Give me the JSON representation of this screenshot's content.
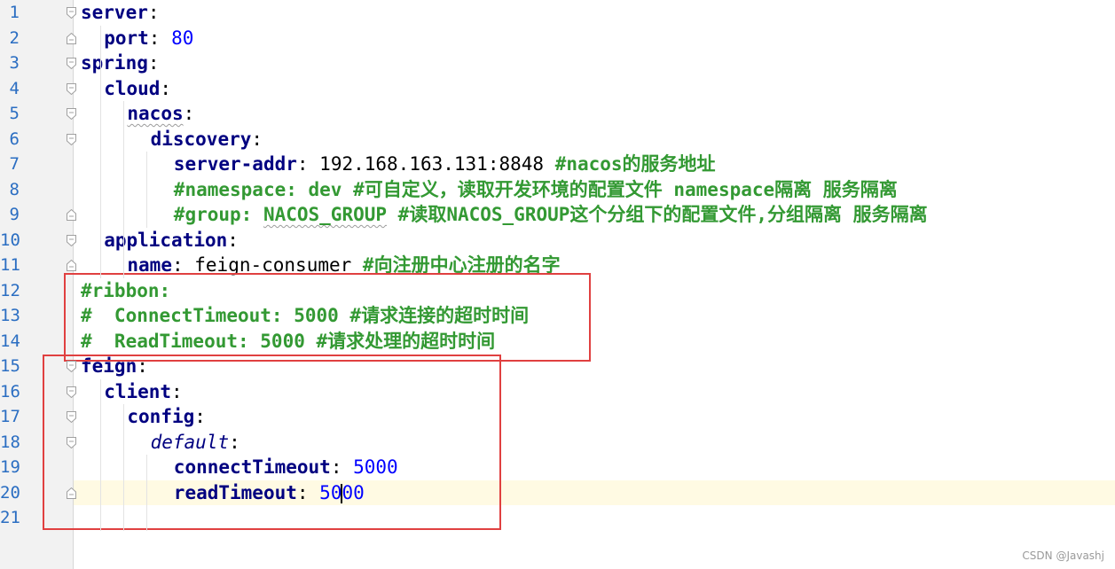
{
  "editor": {
    "language": "yaml",
    "lines": [
      {
        "n": "1",
        "indent": 0,
        "tokens": [
          {
            "t": "server",
            "c": "key"
          },
          {
            "t": ":",
            "c": "punct"
          }
        ]
      },
      {
        "n": "2",
        "indent": 1,
        "tokens": [
          {
            "t": "port",
            "c": "key"
          },
          {
            "t": ": ",
            "c": "punct"
          },
          {
            "t": "80",
            "c": "num"
          }
        ]
      },
      {
        "n": "3",
        "indent": 0,
        "tokens": [
          {
            "t": "spring",
            "c": "key"
          },
          {
            "t": ":",
            "c": "punct"
          }
        ]
      },
      {
        "n": "4",
        "indent": 1,
        "tokens": [
          {
            "t": "cloud",
            "c": "key"
          },
          {
            "t": ":",
            "c": "punct"
          }
        ]
      },
      {
        "n": "5",
        "indent": 2,
        "tokens": [
          {
            "t": "nacos",
            "c": "key",
            "w": 1
          },
          {
            "t": ":",
            "c": "punct"
          }
        ]
      },
      {
        "n": "6",
        "indent": 3,
        "tokens": [
          {
            "t": "discovery",
            "c": "key"
          },
          {
            "t": ":",
            "c": "punct"
          }
        ]
      },
      {
        "n": "7",
        "indent": 4,
        "tokens": [
          {
            "t": "server-addr",
            "c": "key"
          },
          {
            "t": ": ",
            "c": "punct"
          },
          {
            "t": "192.168.163.131:8848 ",
            "c": "str"
          },
          {
            "t": "#nacos的服务地址",
            "c": "cmt"
          }
        ]
      },
      {
        "n": "8",
        "indent": 4,
        "tokens": [
          {
            "t": "#namespace: dev #可自定义，读取开发环境的配置文件 namespace隔离 服务隔离",
            "c": "cmt"
          }
        ]
      },
      {
        "n": "9",
        "indent": 4,
        "tokens": [
          {
            "t": "#group: ",
            "c": "cmt"
          },
          {
            "t": "NACOS_GROUP",
            "c": "cmt",
            "w": 1
          },
          {
            "t": " #读取NACOS_GROUP这个分组下的配置文件,分组隔离 服务隔离",
            "c": "cmt"
          }
        ]
      },
      {
        "n": "10",
        "indent": 1,
        "tokens": [
          {
            "t": "application",
            "c": "key"
          },
          {
            "t": ":",
            "c": "punct"
          }
        ]
      },
      {
        "n": "11",
        "indent": 2,
        "tokens": [
          {
            "t": "name",
            "c": "key"
          },
          {
            "t": ": ",
            "c": "punct"
          },
          {
            "t": "feign-consumer ",
            "c": "str"
          },
          {
            "t": "#向注册中心注册的名字",
            "c": "cmt"
          }
        ]
      },
      {
        "n": "12",
        "indent": 0,
        "tokens": [
          {
            "t": "#ribbon:",
            "c": "cmt"
          }
        ]
      },
      {
        "n": "13",
        "indent": 0,
        "tokens": [
          {
            "t": "#  ConnectTimeout: 5000 #请求连接的超时时间",
            "c": "cmt"
          }
        ]
      },
      {
        "n": "14",
        "indent": 0,
        "tokens": [
          {
            "t": "#  ReadTimeout: 5000 #请求处理的超时时间",
            "c": "cmt"
          }
        ]
      },
      {
        "n": "15",
        "indent": 0,
        "tokens": [
          {
            "t": "feign",
            "c": "key"
          },
          {
            "t": ":",
            "c": "punct"
          }
        ]
      },
      {
        "n": "16",
        "indent": 1,
        "tokens": [
          {
            "t": "client",
            "c": "key"
          },
          {
            "t": ":",
            "c": "punct"
          }
        ]
      },
      {
        "n": "17",
        "indent": 2,
        "tokens": [
          {
            "t": "config",
            "c": "key"
          },
          {
            "t": ":",
            "c": "punct"
          }
        ]
      },
      {
        "n": "18",
        "indent": 3,
        "tokens": [
          {
            "t": "default",
            "c": "ital"
          },
          {
            "t": ":",
            "c": "punct"
          }
        ]
      },
      {
        "n": "19",
        "indent": 4,
        "tokens": [
          {
            "t": "connectTimeout",
            "c": "key"
          },
          {
            "t": ": ",
            "c": "punct"
          },
          {
            "t": "5000",
            "c": "num"
          }
        ]
      },
      {
        "n": "20",
        "indent": 4,
        "tokens": [
          {
            "t": "readTimeout",
            "c": "key"
          },
          {
            "t": ": ",
            "c": "punct"
          },
          {
            "t": "5000",
            "c": "num"
          }
        ],
        "current": true,
        "caret_after": 2
      },
      {
        "n": "21",
        "indent": 0,
        "tokens": []
      }
    ]
  },
  "watermark": "CSDN @Javashj",
  "colors": {
    "key": "#000080",
    "number": "#0000ff",
    "comment": "#339933",
    "highlight_box": "#e04040",
    "current_line": "#fffae3"
  }
}
